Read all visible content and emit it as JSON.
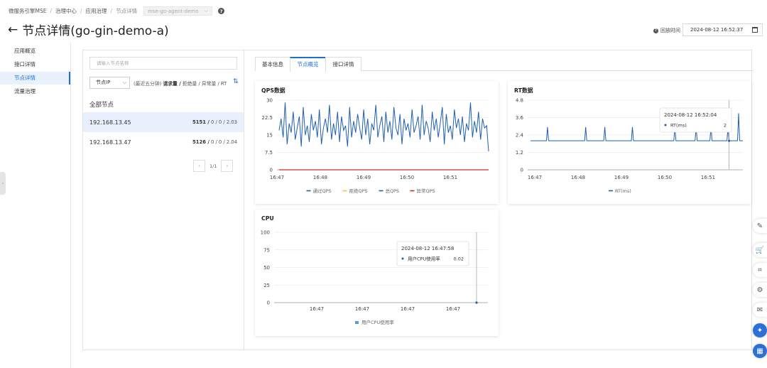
{
  "breadcrumb": [
    "微服务引擎MSE",
    "治理中心",
    "应用治理",
    "节点详情"
  ],
  "namespace_select": "mse-go-agent-demo",
  "page_title": "节点详情(go-gin-demo-a)",
  "replay_label": "回放时间",
  "replay_time": "2024-08-12 16:52:37",
  "sidebar": {
    "items": [
      {
        "label": "应用概览"
      },
      {
        "label": "接口详情"
      },
      {
        "label": "节点详情"
      },
      {
        "label": "流量治理"
      }
    ]
  },
  "node_panel": {
    "search_placeholder": "请输入节点名称",
    "group_select": "节点IP",
    "metric_prefix": "(最近五分钟)",
    "metric_bold": "请求量 /",
    "metric_rest": "拒绝量 / 异常量 / RT",
    "all_nodes": "全部节点",
    "nodes": [
      {
        "ip": "192.168.13.45",
        "bold": "5151 /",
        "rest": "0 / 0 / 2.03"
      },
      {
        "ip": "192.168.13.47",
        "bold": "5126 /",
        "rest": "0 / 0 / 2.04"
      }
    ],
    "pager": "1/1"
  },
  "tabs": [
    {
      "label": "基本信息"
    },
    {
      "label": "节点概览"
    },
    {
      "label": "接口详情"
    }
  ],
  "colors": {
    "accent": "#1f6fd0",
    "series_pass": "#1f5fb0",
    "series_block": "#f5c342",
    "series_total": "#1f5fb0",
    "series_exception": "#d0282e"
  },
  "chart_data": [
    {
      "type": "line",
      "title": "QPS数据",
      "xticks": [
        "16:47",
        "16:48",
        "16:49",
        "16:50",
        "16:51"
      ],
      "yticks": [
        "0",
        "7.5",
        "15",
        "22.5",
        "30"
      ],
      "ylim": [
        0,
        30
      ],
      "legend": [
        "通过QPS",
        "拒绝QPS",
        "总QPS",
        "异常QPS"
      ],
      "legend_position": "bottom",
      "series": [
        {
          "name": "通过QPS",
          "values": [
            17,
            22,
            14,
            29,
            11,
            20,
            16,
            25,
            13,
            18,
            23,
            10,
            27,
            15,
            19,
            12,
            24,
            17,
            21,
            14,
            26,
            11,
            18,
            22,
            16,
            28,
            13,
            20,
            15,
            25,
            12,
            23,
            17,
            19,
            10,
            27,
            14,
            21,
            16,
            24,
            18,
            13,
            26,
            15,
            22,
            11,
            20,
            17,
            28,
            14,
            19,
            23,
            12,
            25,
            16,
            21,
            13,
            27,
            18,
            15,
            24,
            11,
            22,
            17,
            20,
            14,
            26,
            16,
            19,
            23,
            13,
            28,
            15,
            21,
            18,
            12,
            25,
            17,
            22,
            14,
            20,
            27,
            11,
            24,
            16,
            19,
            13,
            26,
            18,
            22,
            15,
            23,
            12,
            20,
            17,
            29,
            14,
            21,
            16,
            25,
            13,
            22,
            18,
            19,
            8
          ]
        },
        {
          "name": "异常QPS",
          "values": [
            0,
            0,
            0,
            0,
            0,
            0,
            0,
            0,
            0,
            0,
            0
          ]
        }
      ]
    },
    {
      "type": "line",
      "title": "RT数据",
      "xticks": [
        "16:47",
        "16:48",
        "16:49",
        "16:50",
        "16:51"
      ],
      "yticks": [
        "0",
        "1.2",
        "2.4",
        "3.6",
        "4.8"
      ],
      "ylim": [
        0,
        4.8
      ],
      "legend": [
        "RT(ms)"
      ],
      "legend_position": "bottom",
      "tooltip": {
        "time": "2024-08-12 16:52:04",
        "label": "RT(ms)",
        "value": "2"
      },
      "spikes_x": [
        0.08,
        0.26,
        0.35,
        0.48,
        0.68,
        0.78,
        0.85,
        0.93,
        0.98
      ],
      "baseline": 2
    },
    {
      "type": "line",
      "title": "CPU",
      "xticks": [
        "16:47",
        "16:47",
        "16:47",
        "16:47"
      ],
      "yticks": [
        "0",
        "25",
        "50",
        "75",
        "100"
      ],
      "ylim": [
        0,
        100
      ],
      "legend": [
        "用户CPU使用率"
      ],
      "legend_position": "bottom",
      "tooltip": {
        "time": "2024-08-12 16:47:58",
        "label": "用户CPU使用率",
        "value": "0.02"
      }
    }
  ],
  "float_icons": [
    "edit-icon",
    "cart-icon",
    "tag-icon",
    "settings-icon",
    "message-icon",
    "ai-icon",
    "apps-icon"
  ]
}
